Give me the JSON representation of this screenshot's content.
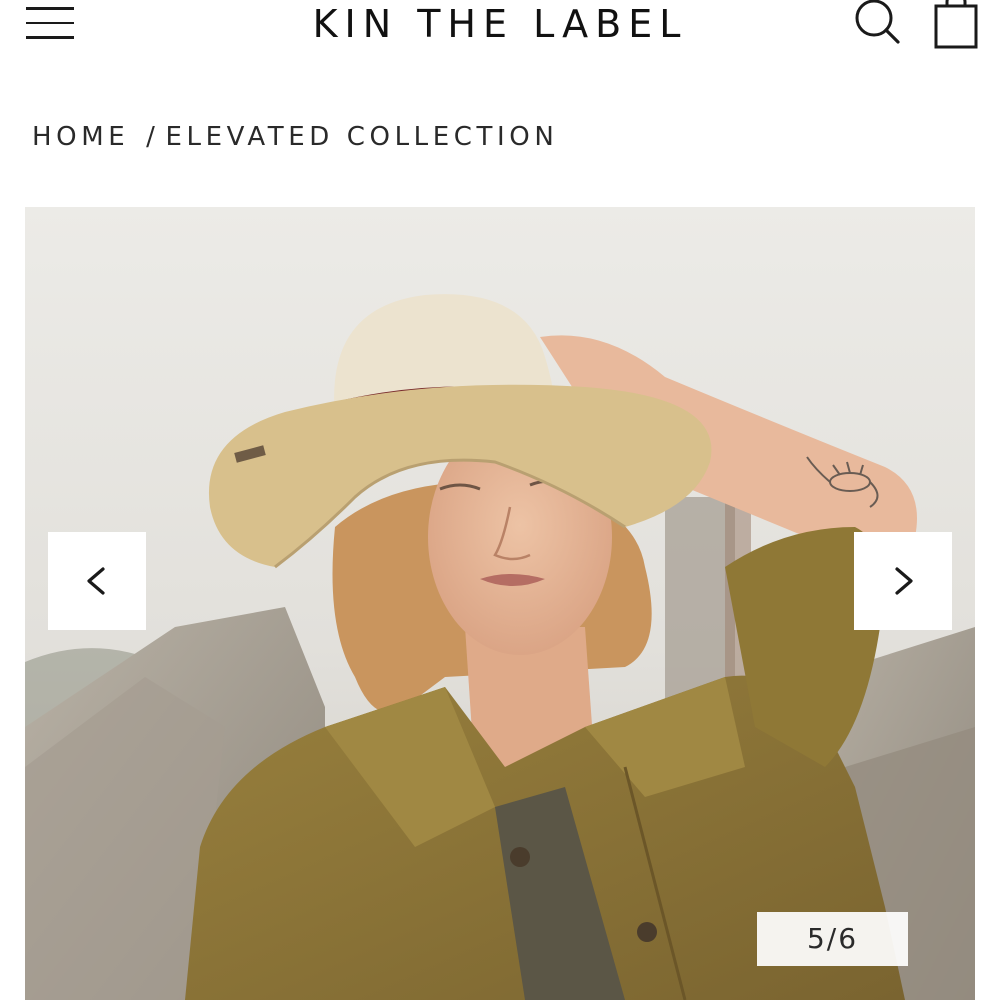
{
  "header": {
    "logo": "KIN THE LABEL",
    "menu_icon": "hamburger-menu-icon",
    "search_icon": "search-icon",
    "cart_icon": "shopping-bag-icon"
  },
  "breadcrumb": {
    "home": "HOME",
    "separator": "/",
    "current": "ELEVATED COLLECTION"
  },
  "gallery": {
    "prev_icon": "chevron-left-icon",
    "next_icon": "chevron-right-icon",
    "counter": "5/6",
    "image_subject": "model-wearing-straw-fedora-photo"
  },
  "colors": {
    "text": "#1a1a1a",
    "background": "#ffffff",
    "sky": "#e9e8e4",
    "jacket": "#8d7636",
    "hat": "#d8c08c",
    "hat_band": "#7a2d2e"
  }
}
